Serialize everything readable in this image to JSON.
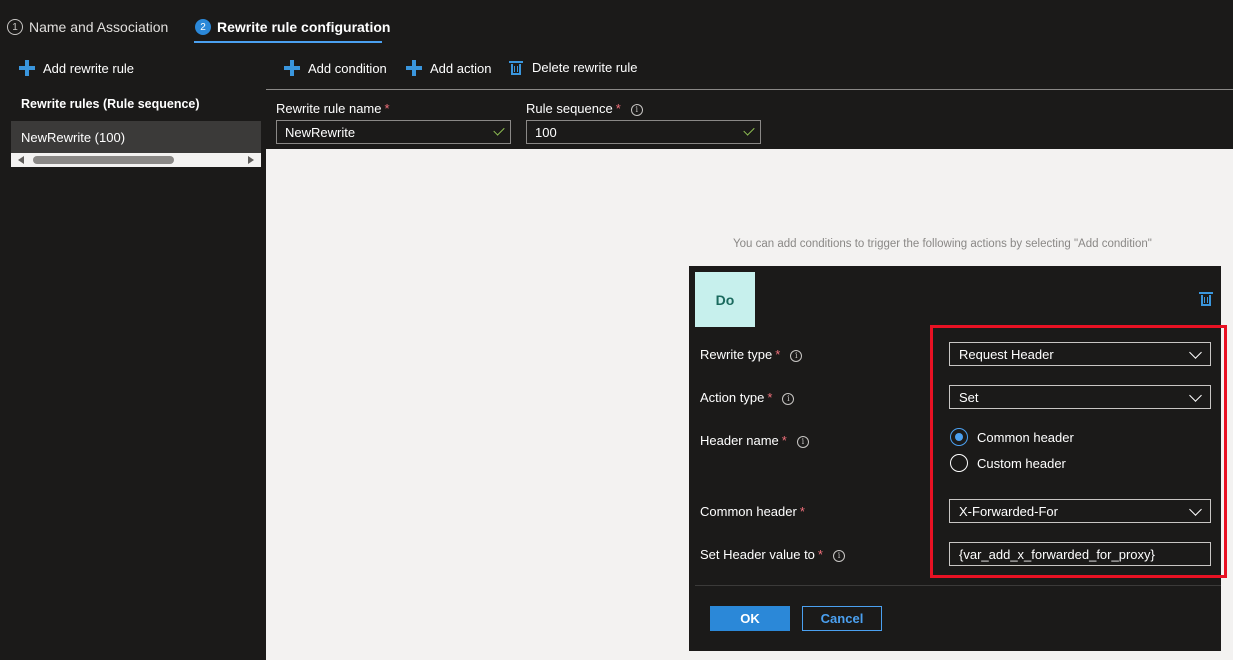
{
  "wizard": {
    "steps": [
      {
        "number": "1",
        "label": "Name and Association"
      },
      {
        "number": "2",
        "label": "Rewrite rule configuration"
      }
    ]
  },
  "left_panel": {
    "add_rule_label": "Add rewrite rule",
    "rules_heading": "Rewrite rules (Rule sequence)",
    "rules": [
      "NewRewrite (100)"
    ]
  },
  "toolbar": {
    "add_condition_label": "Add condition",
    "add_action_label": "Add action",
    "delete_rule_label": "Delete rewrite rule"
  },
  "form": {
    "rule_name_label": "Rewrite rule name",
    "rule_name_value": "NewRewrite",
    "rule_sequence_label": "Rule sequence",
    "rule_sequence_value": "100",
    "required_marker": "*"
  },
  "canvas": {
    "hint": "You can add conditions to trigger the following actions by selecting \"Add condition\""
  },
  "do_card": {
    "title": "Do",
    "rewrite_type_label": "Rewrite type",
    "rewrite_type_value": "Request Header",
    "action_type_label": "Action type",
    "action_type_value": "Set",
    "header_name_label": "Header name",
    "header_options": [
      "Common header",
      "Custom header"
    ],
    "header_selected": "Common header",
    "common_header_label": "Common header",
    "common_header_value": "X-Forwarded-For",
    "set_value_label": "Set Header value to",
    "set_value_value": "{var_add_x_forwarded_for_proxy}",
    "ok_label": "OK",
    "cancel_label": "Cancel"
  },
  "colors": {
    "accent": "#2b88d8",
    "highlight": "#e81123",
    "do_tile_bg": "#c7f0ed"
  },
  "icons": [
    "plus-icon",
    "trash-icon",
    "info-icon",
    "chevron-down-icon",
    "check-icon"
  ]
}
